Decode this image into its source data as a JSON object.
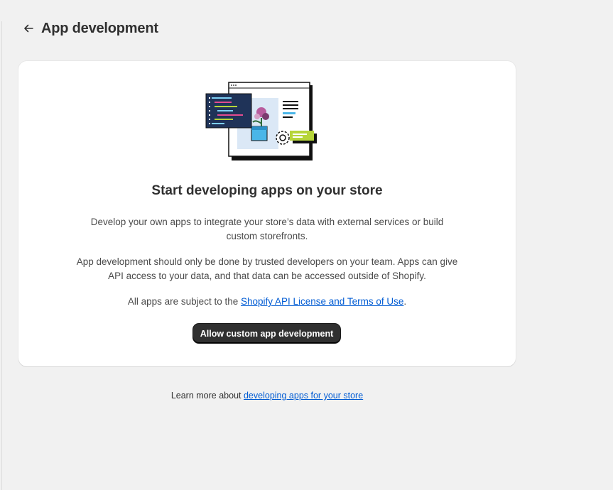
{
  "header": {
    "back_icon": "arrow-left-icon",
    "title": "App development"
  },
  "empty_state": {
    "illustration": "app-development-illustration",
    "title": "Start developing apps on your store",
    "paragraph1": "Develop your own apps to integrate your store’s data with external services or build custom storefronts.",
    "paragraph2": "App development should only be done by trusted developers on your team. Apps can give API access to your data, and that data can be accessed outside of Shopify.",
    "terms_prefix": "All apps are subject to the ",
    "terms_link": "Shopify API License and Terms of Use",
    "terms_suffix": ".",
    "button_label": "Allow custom app development"
  },
  "footer": {
    "prefix": "Learn more about ",
    "link": "developing apps for your store"
  },
  "colors": {
    "primary_button": "#303030",
    "link": "#005bd3",
    "accent_green": "#b6d53a",
    "accent_blue": "#4ab6e8",
    "code_bg": "#1f3358"
  }
}
